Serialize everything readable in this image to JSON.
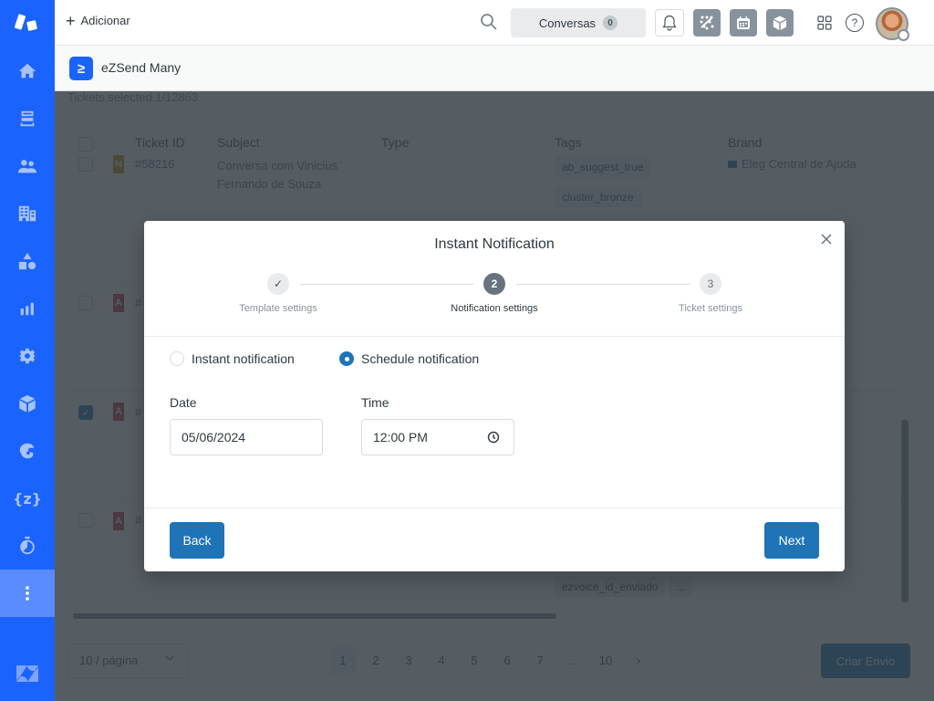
{
  "topbar": {
    "add_label": "Adicionar",
    "conversations_label": "Conversas",
    "conversations_count": "0",
    "help_glyph": "?"
  },
  "sidebar": {
    "items": [
      {
        "name": "home",
        "icon": "home-icon"
      },
      {
        "name": "views",
        "icon": "inbox-icon"
      },
      {
        "name": "customers",
        "icon": "users-icon"
      },
      {
        "name": "organizations",
        "icon": "building-icon"
      },
      {
        "name": "objects",
        "icon": "shapes-icon"
      },
      {
        "name": "reporting",
        "icon": "bar-chart-icon"
      },
      {
        "name": "admin",
        "icon": "gear-icon"
      },
      {
        "name": "apps",
        "icon": "cube-icon"
      },
      {
        "name": "mailchimp",
        "icon": "mailchimp-icon"
      },
      {
        "name": "placeholders",
        "icon": "braces-icon"
      },
      {
        "name": "timer",
        "icon": "stopwatch-icon"
      },
      {
        "name": "more",
        "icon": "more-vertical-icon"
      }
    ],
    "active": "more"
  },
  "app": {
    "title": "eZSend Many"
  },
  "background": {
    "selection_text": "Tickets selected 1/12863",
    "columns": [
      "Ticket ID",
      "Subject",
      "Type",
      "Tags",
      "Brand"
    ],
    "rows": [
      {
        "status": "N",
        "id": "#58216",
        "subject": "Conversa com Vinicius Fernando de Souza",
        "tags": [
          "ab_suggest_true",
          "cluster_bronze"
        ],
        "brand": "Eleg Central de Ajuda",
        "checked": false
      },
      {
        "status": "A",
        "id": "#",
        "subject": "",
        "tags": [],
        "brand": "",
        "checked": false
      },
      {
        "status": "A",
        "id": "#",
        "subject": "",
        "tags": [],
        "brand": "",
        "checked": true
      },
      {
        "status": "A",
        "id": "#",
        "subject": "",
        "tags": [
          "ezvoice_id_enviado",
          "..."
        ],
        "brand": "",
        "checked": false
      }
    ],
    "page_size": "10 / página",
    "pages": [
      "1",
      "2",
      "3",
      "4",
      "5",
      "6",
      "7",
      "...",
      "10"
    ],
    "current_page": "1",
    "next_glyph": "›",
    "create_button": "Criar Envio"
  },
  "modal": {
    "title": "Instant Notification",
    "steps": [
      {
        "label": "Template settings",
        "state": "done",
        "marker": "✓"
      },
      {
        "label": "Notification settings",
        "state": "current",
        "marker": "2"
      },
      {
        "label": "Ticket settings",
        "state": "todo",
        "marker": "3"
      }
    ],
    "options": [
      {
        "label": "Instant notification",
        "selected": false
      },
      {
        "label": "Schedule notification",
        "selected": true
      }
    ],
    "date_label": "Date",
    "date_value": "05/06/2024",
    "time_label": "Time",
    "time_value": "12:00 PM",
    "back_label": "Back",
    "next_label": "Next"
  },
  "colors": {
    "sidebar": "#1a63ff",
    "primary_button": "#1f73b7",
    "overlay": "#2f3941"
  }
}
